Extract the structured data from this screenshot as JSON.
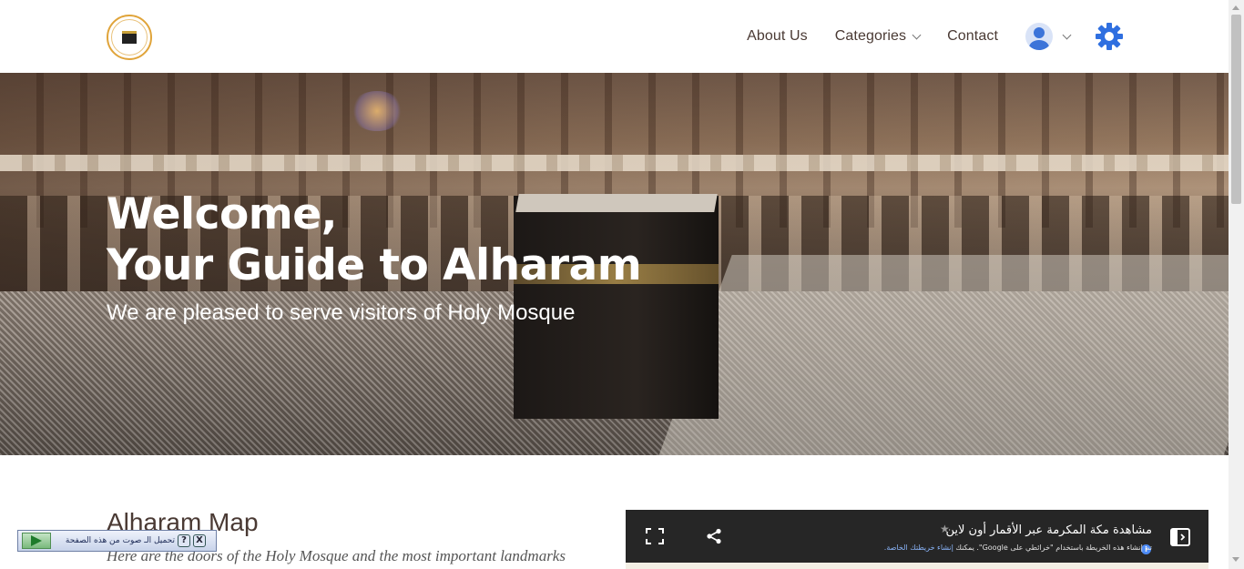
{
  "nav": {
    "links": [
      "About Us",
      "Categories",
      "Contact"
    ],
    "logo_icon": "kaaba-logo",
    "user_icon": "user-avatar-icon",
    "settings_icon": "gear-icon"
  },
  "hero": {
    "title_line1": "Welcome,",
    "title_line2": "Your Guide to Alharam",
    "subtitle": "We are pleased to serve visitors of Holy Mosque"
  },
  "map_section": {
    "title": "Alharam Map",
    "description": "Here are the doors of the Holy Mosque and the most important landmarks",
    "embed": {
      "title": "مشاهدة مكة المكرمة عبر الأقمار أون لاين",
      "note_prefix": "تم إنشاء هذه الخريطة باستخدام \"خرائطي على Google\". يمكنك ",
      "note_link": "إنشاء خريطتك الخاصة.",
      "icons": [
        "fullscreen-icon",
        "share-icon",
        "star-icon",
        "info-icon",
        "side-panel-icon"
      ]
    }
  },
  "audio_widget": {
    "label": "تحميل الـ صوت من هذه الصفحة",
    "help": "?",
    "close": "X"
  },
  "colors": {
    "nav_text": "#4a3a34",
    "accent_gold": "#e0a43a",
    "user_blue": "#3c74d9",
    "map_bg": "#262626"
  }
}
